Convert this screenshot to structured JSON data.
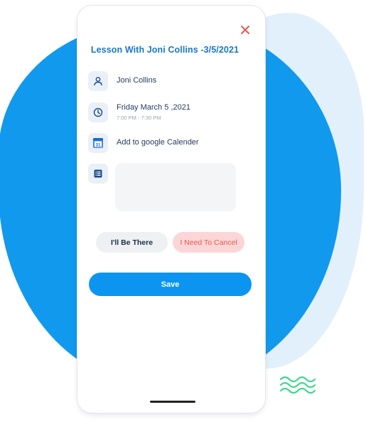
{
  "modal": {
    "title": "Lesson With Joni Collins -3/5/2021",
    "person": "Joni Collins",
    "date": "Friday March 5 ,2021",
    "time": "7:00 PM - 7:30 PM",
    "calendar_label": "Add to google Calender",
    "calendar_day": "31",
    "notes_value": "",
    "attend_label": "I'll Be There",
    "cancel_label": "I Need To Cancel",
    "save_label": "Save"
  },
  "icons": {
    "close": "close-icon",
    "person": "person-icon",
    "clock": "clock-icon",
    "calendar": "google-calendar-icon",
    "notes": "notes-icon",
    "decoration": "wave-icon"
  },
  "colors": {
    "primary": "#0b95f0",
    "title": "#1877c9",
    "blob": "#1199ee",
    "blob_light": "#e2f0fc",
    "cancel_bg": "#fcd6d6",
    "cancel_text": "#e8574f",
    "close": "#e8574f",
    "wave": "#3dd68c"
  }
}
